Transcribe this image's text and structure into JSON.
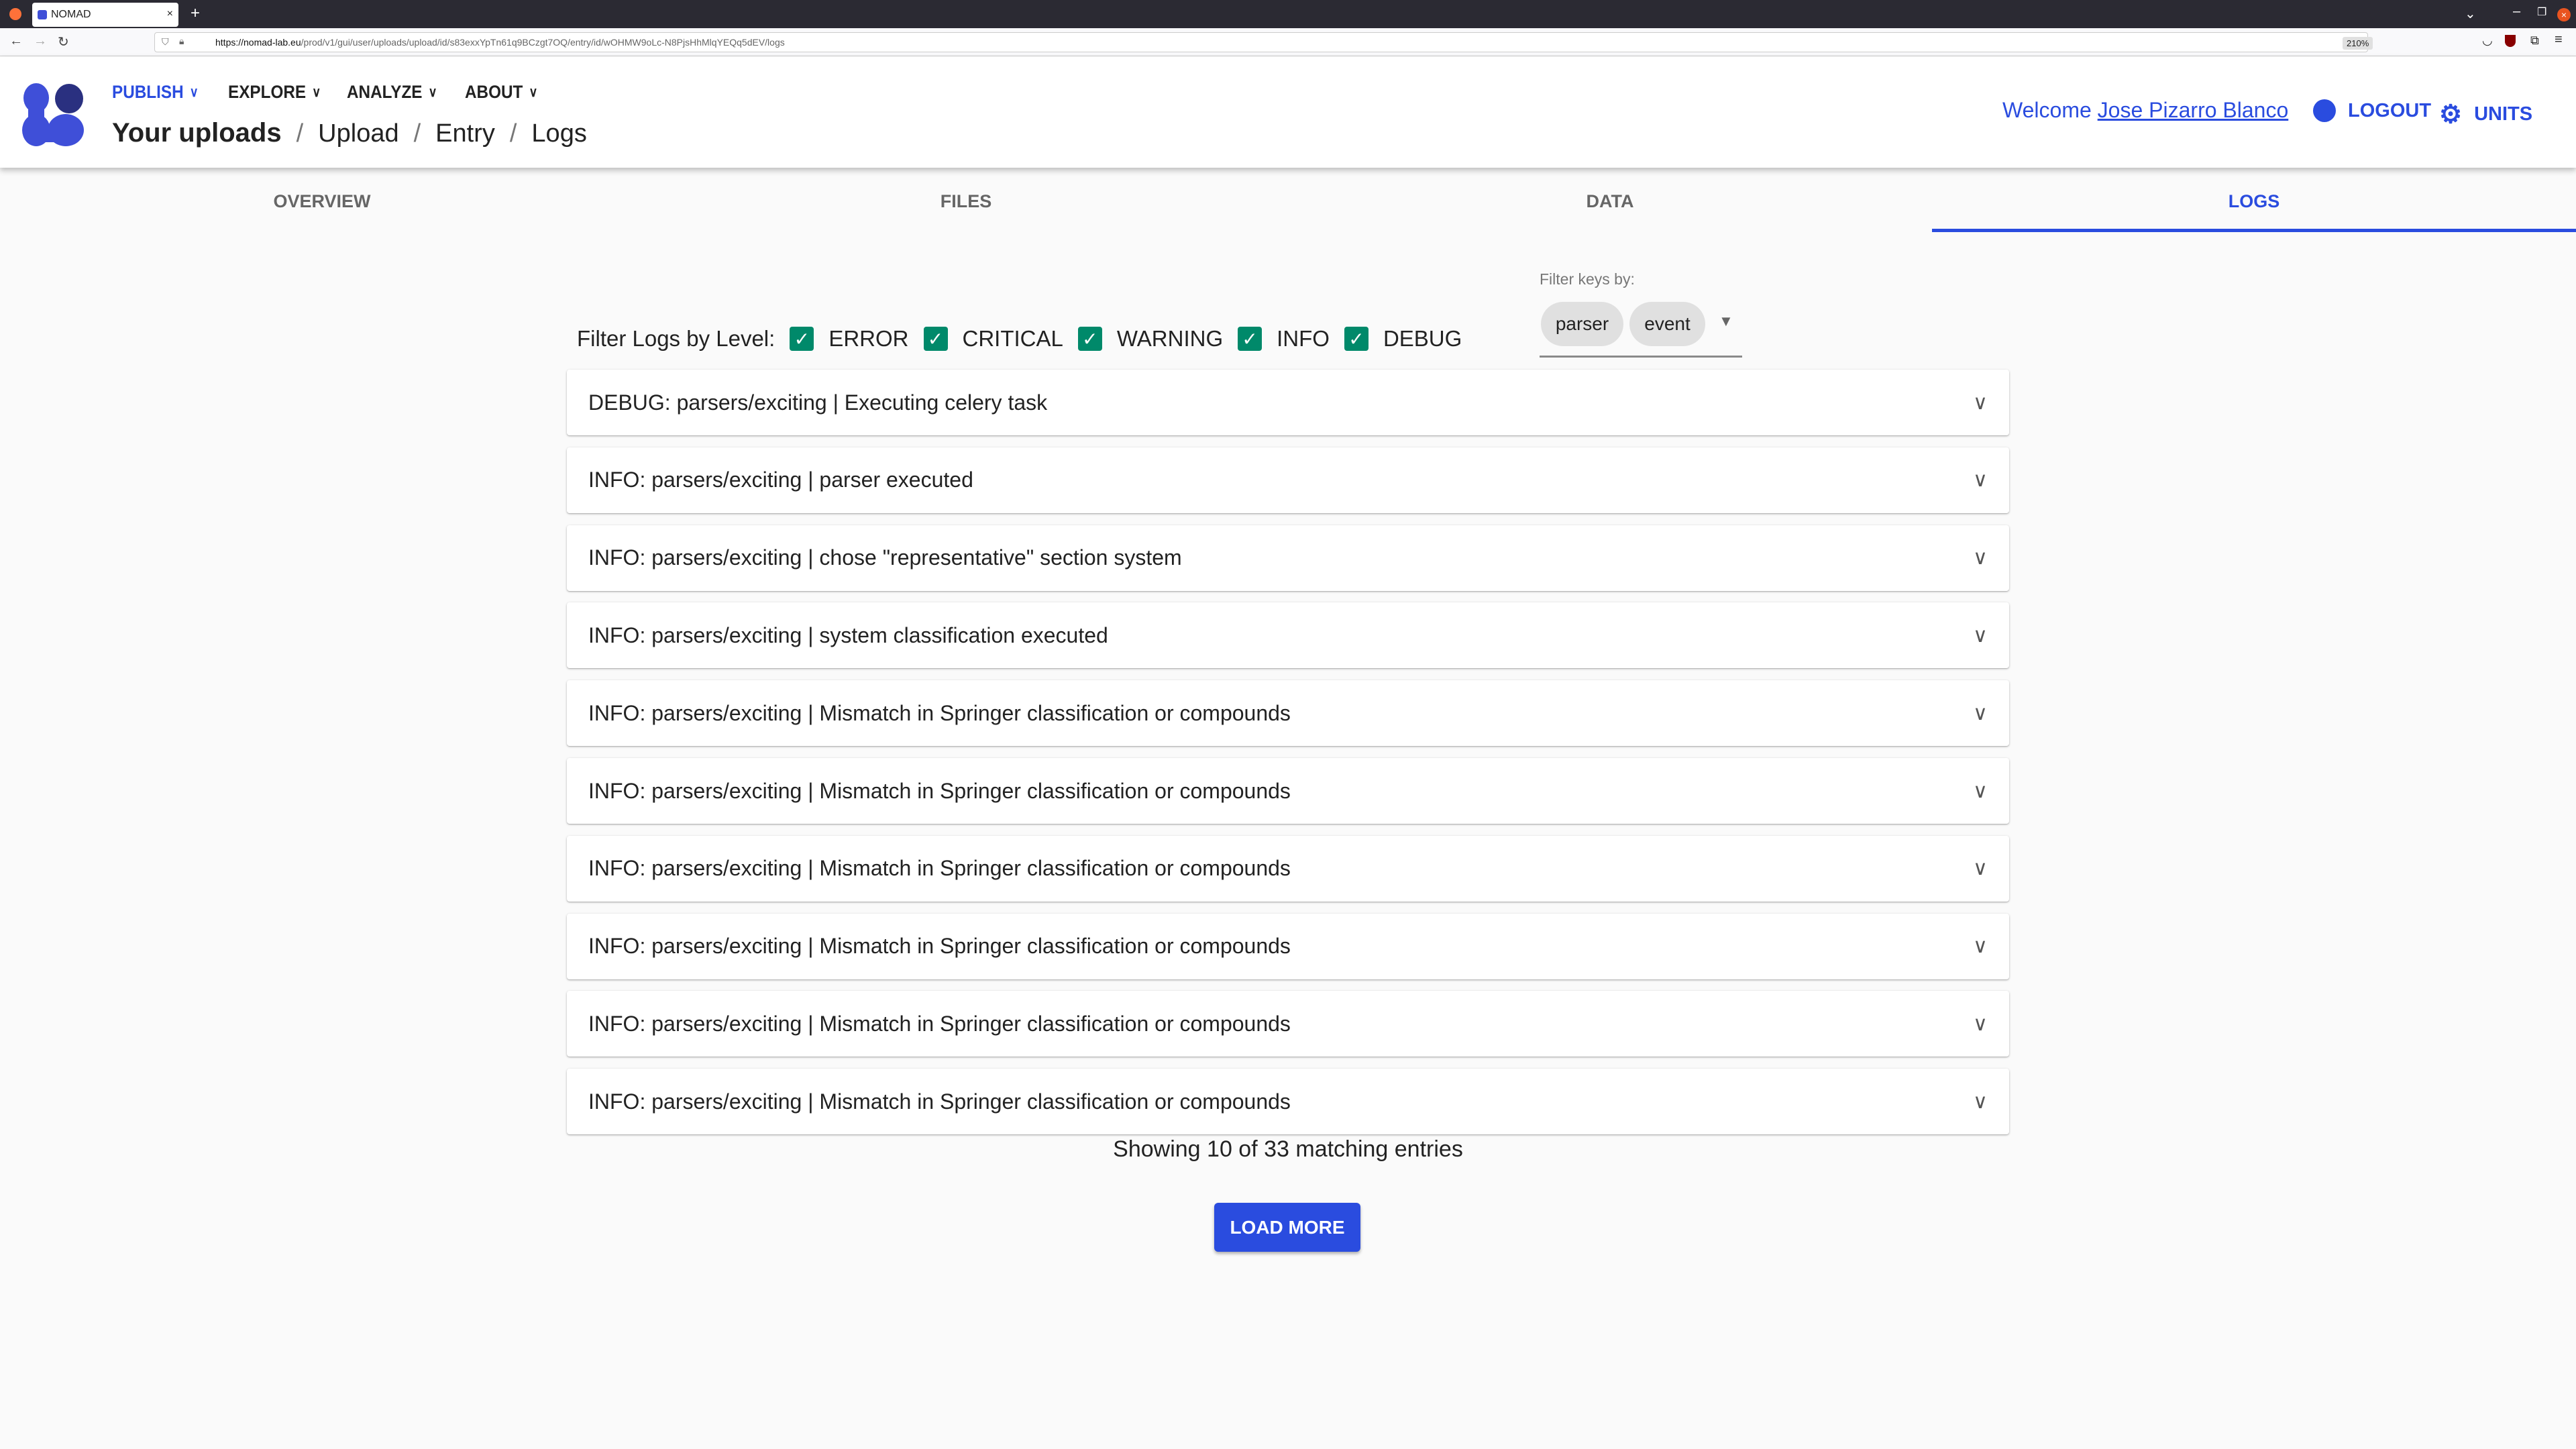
{
  "browser": {
    "tab_title": "NOMAD",
    "url_host": "https://nomad-lab.eu",
    "url_path": "/prod/v1/gui/user/uploads/upload/id/s83exxYpTn61q9BCzgt7OQ/entry/id/wOHMW9oLc-N8PjsHhMlqYEQq5dEV/logs",
    "zoom": "210%"
  },
  "nav": {
    "menus": [
      "PUBLISH",
      "EXPLORE",
      "ANALYZE",
      "ABOUT"
    ],
    "breadcrumb": [
      "Your uploads",
      "Upload",
      "Entry",
      "Logs"
    ],
    "welcome": "Welcome ",
    "user": "Jose Pizarro Blanco",
    "logout": "LOGOUT",
    "units": "UNITS"
  },
  "tabs": [
    "OVERVIEW",
    "FILES",
    "DATA",
    "LOGS"
  ],
  "filters": {
    "label": "Filter Logs by Level:",
    "levels": [
      "ERROR",
      "CRITICAL",
      "WARNING",
      "INFO",
      "DEBUG"
    ],
    "keys_label": "Filter keys by:",
    "keys": [
      "parser",
      "event"
    ]
  },
  "logs": [
    "DEBUG: parsers/exciting | Executing celery task",
    "INFO: parsers/exciting | parser executed",
    "INFO: parsers/exciting | chose \"representative\" section system",
    "INFO: parsers/exciting | system classification executed",
    "INFO: parsers/exciting | Mismatch in Springer classification or compounds",
    "INFO: parsers/exciting | Mismatch in Springer classification or compounds",
    "INFO: parsers/exciting | Mismatch in Springer classification or compounds",
    "INFO: parsers/exciting | Mismatch in Springer classification or compounds",
    "INFO: parsers/exciting | Mismatch in Springer classification or compounds",
    "INFO: parsers/exciting | Mismatch in Springer classification or compounds"
  ],
  "showing": "Showing 10 of 33 matching entries",
  "load_more": "LOAD MORE",
  "colors": {
    "primary": "#2a4cdf",
    "check": "#00896a"
  }
}
